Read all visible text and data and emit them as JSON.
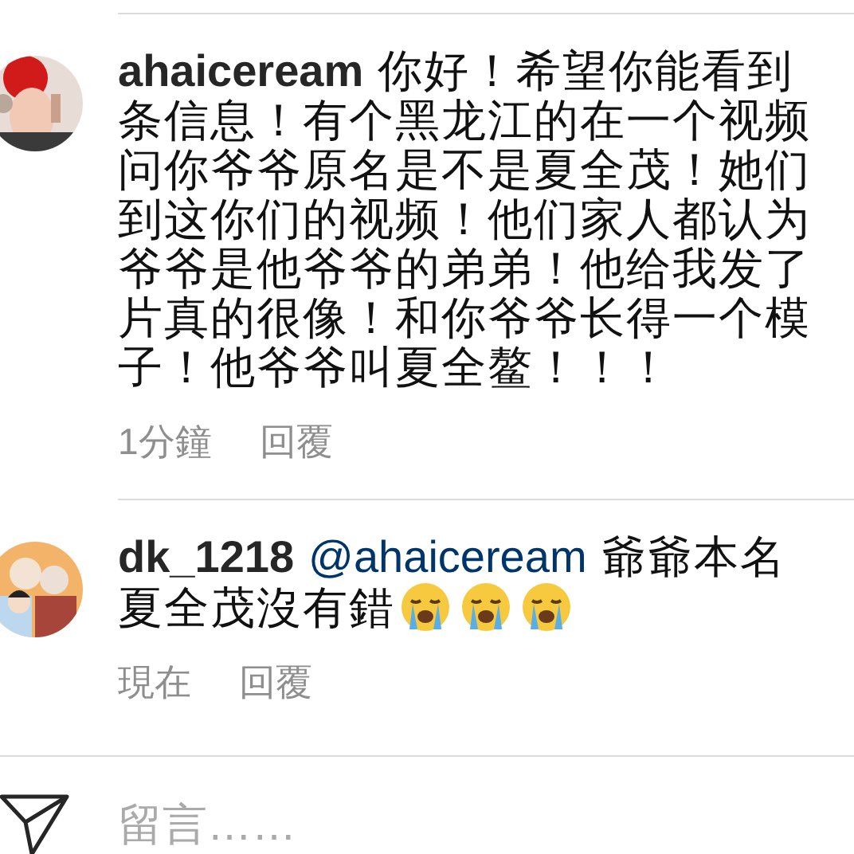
{
  "comments": [
    {
      "username": "ahaiceream",
      "lines": [
        "你好！希望你能看到",
        "条信息！有个黑龙江的在一个视频",
        "问你爷爷原名是不是夏全茂！她们",
        "到这你们的视频！他们家人都认为",
        "爷爷是他爷爷的弟弟！他给我发了",
        "片真的很像！和你爷爷长得一个模",
        "子！他爷爷叫夏全鳌！！！"
      ],
      "time": "1分鐘",
      "reply": "回覆"
    },
    {
      "username": "dk_1218",
      "mention": "@ahaiceream",
      "lines": [
        "爺爺本名",
        "夏全茂沒有錯"
      ],
      "emojis": [
        {
          "kind": "crying-face"
        },
        {
          "kind": "crying-face"
        },
        {
          "kind": "crying-face"
        }
      ],
      "time": "現在",
      "reply": "回覆"
    }
  ],
  "comment_box": {
    "placeholder": "留言……"
  }
}
